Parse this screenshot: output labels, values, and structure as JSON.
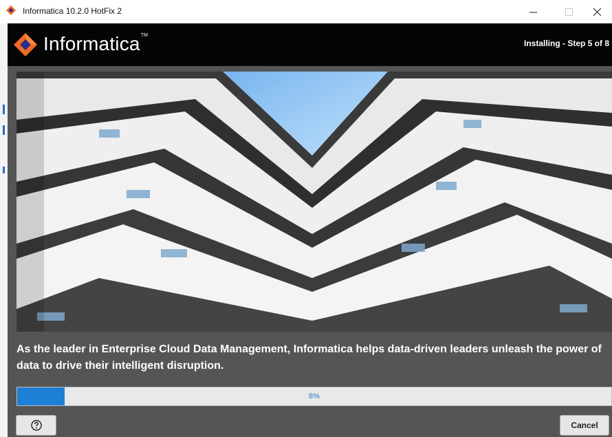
{
  "window": {
    "title": "Informatica 10.2.0 HotFix 2",
    "app_icon": "informatica-diamond-icon",
    "controls": [
      "minimize-icon",
      "maximize-icon",
      "close-icon"
    ]
  },
  "header": {
    "brand": "Informatica",
    "brand_mark": "TM",
    "step_label": "Installing - Step 5 of 8"
  },
  "hero": {
    "image": "building-courtyard-photo"
  },
  "tagline": "As the leader in Enterprise Cloud Data Management, Informatica helps data-driven leaders unleash the power of data to drive their intelligent disruption.",
  "progress": {
    "percent": 8,
    "label": "8%"
  },
  "footer": {
    "help_icon": "help-icon",
    "cancel_label": "Cancel"
  },
  "colors": {
    "brand_orange": "#f26a21",
    "header_bg": "#050505",
    "panel_bg": "#555555",
    "progress_fill": "#1d7fd6"
  }
}
